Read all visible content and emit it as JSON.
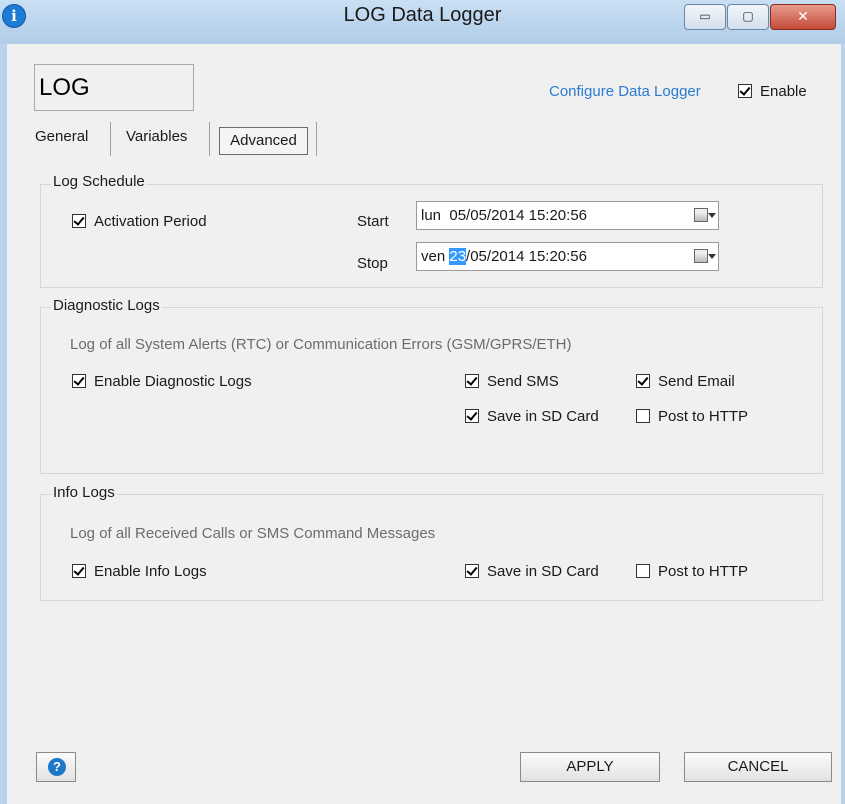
{
  "window": {
    "title": "LOG Data Logger",
    "icon_glyph": "i",
    "minimize_glyph": "▭",
    "maximize_glyph": "▢",
    "close_glyph": "✕"
  },
  "header": {
    "name_value": "LOG",
    "configure_link": "Configure Data Logger",
    "enable_label": "Enable",
    "enable_checked": true
  },
  "tabs": [
    {
      "label": "General",
      "active": false
    },
    {
      "label": "Variables",
      "active": false
    },
    {
      "label": "Advanced",
      "active": true
    }
  ],
  "log_schedule": {
    "title": "Log Schedule",
    "activation_label": "Activation Period",
    "activation_checked": true,
    "start_label": "Start",
    "start_day": "lun",
    "start_value": "05/05/2014 15:20:56",
    "stop_label": "Stop",
    "stop_day": "ven",
    "stop_selected": "23",
    "stop_value_rest": "/05/2014 15:20:56"
  },
  "diagnostic_logs": {
    "title": "Diagnostic Logs",
    "description": "Log of all System Alerts (RTC) or Communication Errors (GSM/GPRS/ETH)",
    "enable_label": "Enable Diagnostic Logs",
    "send_sms": "Send SMS",
    "send_email": "Send Email",
    "save_sd": "Save in SD Card",
    "post_http": "Post to HTTP"
  },
  "info_logs": {
    "title": "Info Logs",
    "description": "Log of all Received Calls or SMS Command Messages",
    "enable_label": "Enable Info Logs",
    "save_sd": "Save in SD Card",
    "post_http": "Post to HTTP"
  },
  "footer": {
    "help_glyph": "?",
    "apply_label": "APPLY",
    "cancel_label": "CANCEL"
  },
  "colors": {
    "link": "#2b7bd1",
    "selection": "#3399ff"
  }
}
